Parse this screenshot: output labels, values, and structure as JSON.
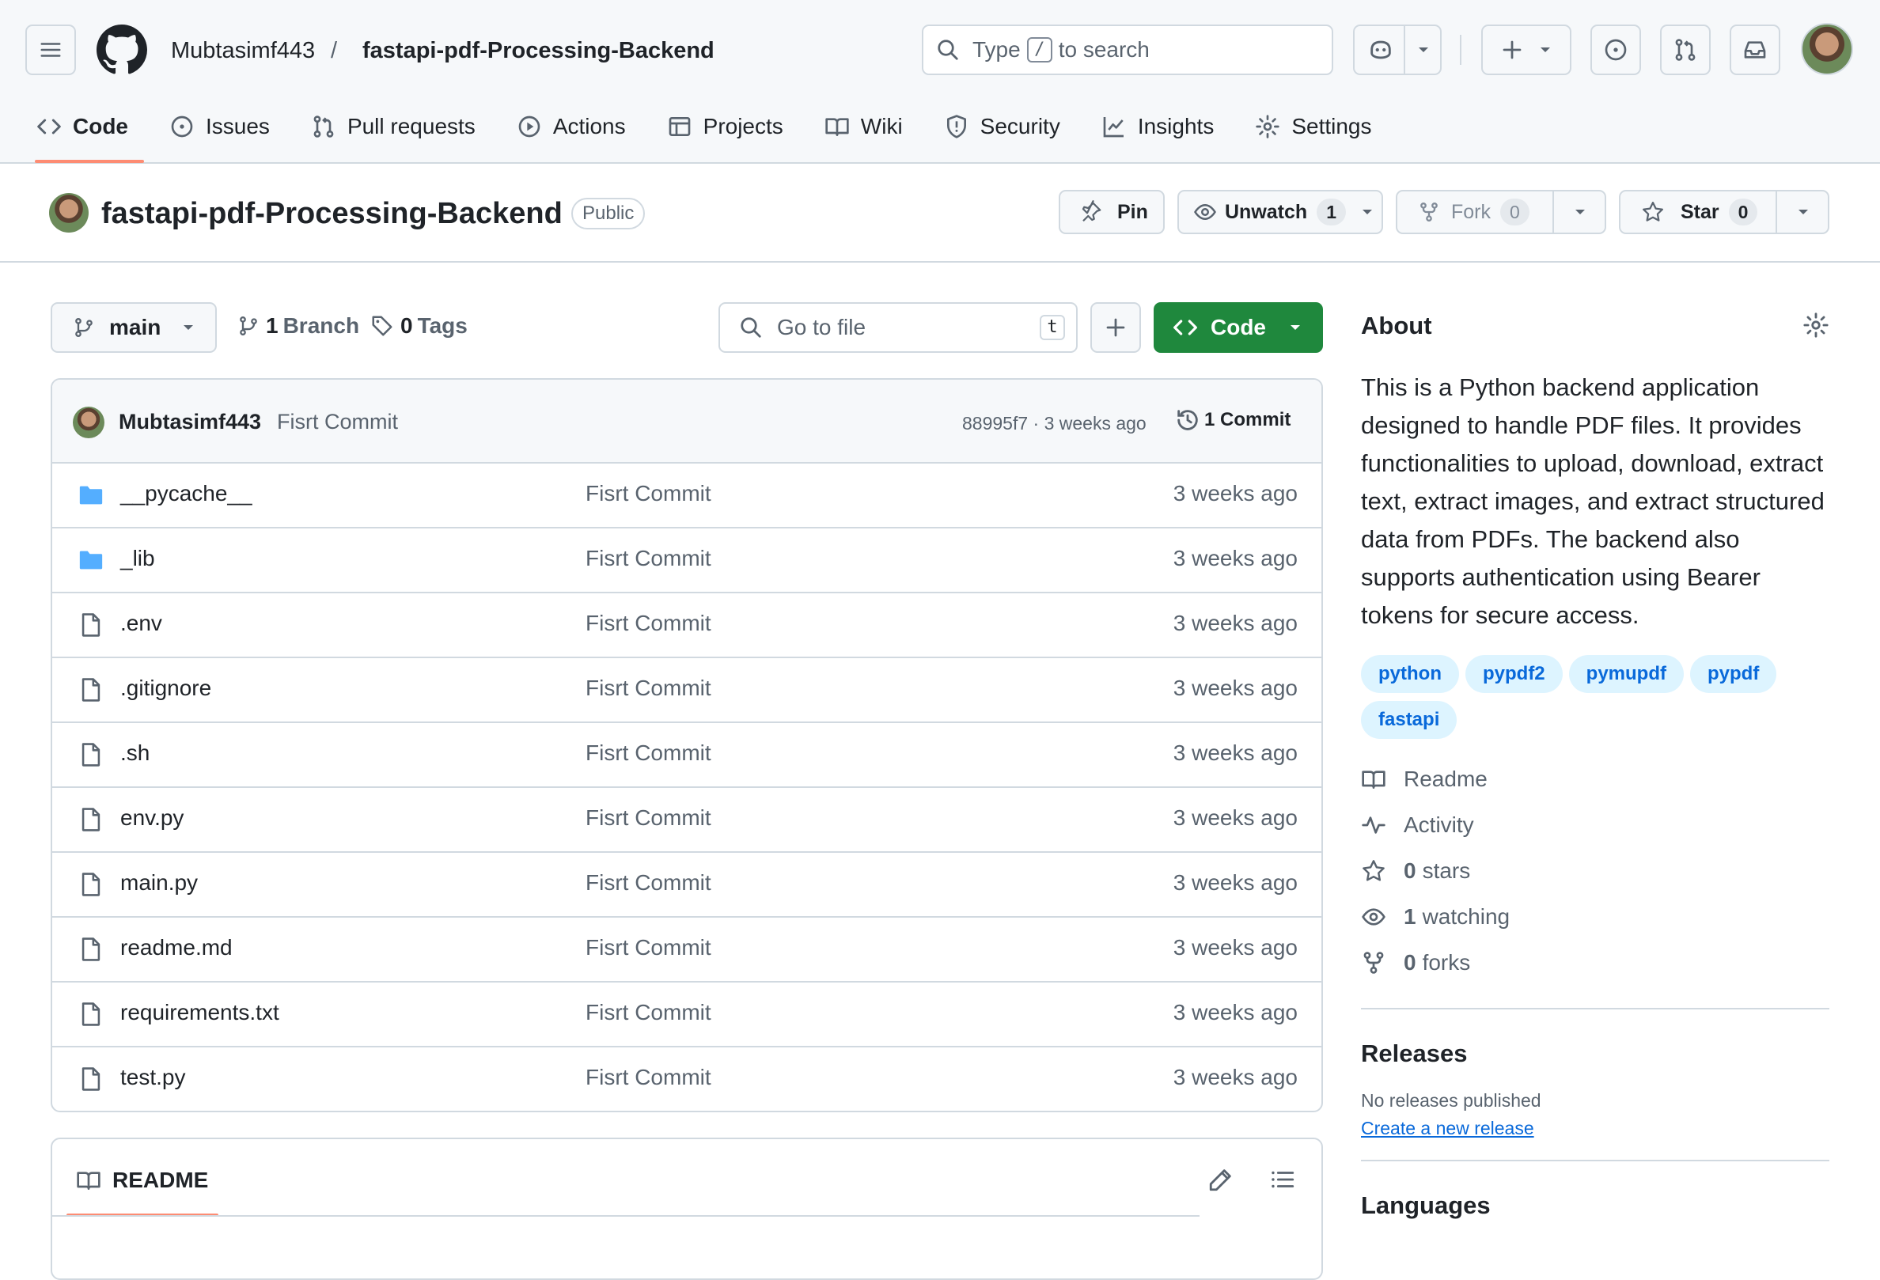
{
  "header": {
    "owner": "Mubtasimf443",
    "separator": "/",
    "repo": "fastapi-pdf-Processing-Backend",
    "search_prefix": "Type",
    "search_key": "/",
    "search_suffix": "to search"
  },
  "tabs": [
    {
      "label": "Code",
      "icon": "code-icon"
    },
    {
      "label": "Issues",
      "icon": "issue-icon"
    },
    {
      "label": "Pull requests",
      "icon": "pull-request-icon"
    },
    {
      "label": "Actions",
      "icon": "play-icon"
    },
    {
      "label": "Projects",
      "icon": "table-icon"
    },
    {
      "label": "Wiki",
      "icon": "book-icon"
    },
    {
      "label": "Security",
      "icon": "shield-icon"
    },
    {
      "label": "Insights",
      "icon": "graph-icon"
    },
    {
      "label": "Settings",
      "icon": "gear-icon"
    }
  ],
  "repo_header": {
    "name": "fastapi-pdf-Processing-Backend",
    "visibility": "Public",
    "pin": "Pin",
    "unwatch": "Unwatch",
    "watch_count": "1",
    "fork": "Fork",
    "fork_count": "0",
    "star": "Star",
    "star_count": "0"
  },
  "toolbar": {
    "branch": "main",
    "branch_count": "1",
    "branch_label": "Branch",
    "tag_count": "0",
    "tag_label": "Tags",
    "goto_placeholder": "Go to file",
    "goto_key": "t",
    "code_button": "Code"
  },
  "latest_commit": {
    "author": "Mubtasimf443",
    "message": "Fisrt Commit",
    "hash_time": "88995f7 · 3 weeks ago",
    "commit_count": "1 Commit"
  },
  "files": [
    {
      "name": "__pycache__",
      "type": "folder",
      "message": "Fisrt Commit",
      "age": "3 weeks ago"
    },
    {
      "name": "_lib",
      "type": "folder",
      "message": "Fisrt Commit",
      "age": "3 weeks ago"
    },
    {
      "name": ".env",
      "type": "file",
      "message": "Fisrt Commit",
      "age": "3 weeks ago"
    },
    {
      "name": ".gitignore",
      "type": "file",
      "message": "Fisrt Commit",
      "age": "3 weeks ago"
    },
    {
      "name": ".sh",
      "type": "file",
      "message": "Fisrt Commit",
      "age": "3 weeks ago"
    },
    {
      "name": "env.py",
      "type": "file",
      "message": "Fisrt Commit",
      "age": "3 weeks ago"
    },
    {
      "name": "main.py",
      "type": "file",
      "message": "Fisrt Commit",
      "age": "3 weeks ago"
    },
    {
      "name": "readme.md",
      "type": "file",
      "message": "Fisrt Commit",
      "age": "3 weeks ago"
    },
    {
      "name": "requirements.txt",
      "type": "file",
      "message": "Fisrt Commit",
      "age": "3 weeks ago"
    },
    {
      "name": "test.py",
      "type": "file",
      "message": "Fisrt Commit",
      "age": "3 weeks ago"
    }
  ],
  "readme": {
    "title": "README"
  },
  "about": {
    "title": "About",
    "description": "This is a Python backend application designed to handle PDF files. It provides functionalities to upload, download, extract text, extract images, and extract structured data from PDFs. The backend also supports authentication using Bearer tokens for secure access.",
    "topics": [
      "python",
      "pypdf2",
      "pymupdf",
      "pypdf",
      "fastapi"
    ],
    "readme": "Readme",
    "activity": "Activity",
    "stars_count": "0",
    "stars_label": "stars",
    "watching_count": "1",
    "watching_label": "watching",
    "forks_count": "0",
    "forks_label": "forks"
  },
  "releases": {
    "title": "Releases",
    "none": "No releases published",
    "create": "Create a new release"
  },
  "languages": {
    "title": "Languages"
  },
  "colors": {
    "accent": "#fd8c73",
    "green": "#1f883d",
    "link": "#0969da",
    "folder": "#54aeff"
  }
}
